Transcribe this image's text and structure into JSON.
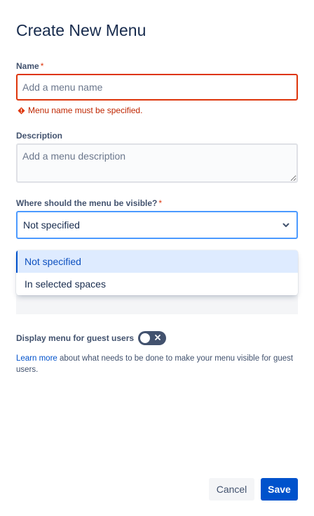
{
  "dialog": {
    "title": "Create New Menu"
  },
  "name_field": {
    "label": "Name",
    "required_mark": "*",
    "placeholder": "Add a menu name",
    "value": "",
    "error": "Menu name must be specified."
  },
  "description_field": {
    "label": "Description",
    "placeholder": "Add a menu description",
    "value": ""
  },
  "visibility_field": {
    "label": "Where should the menu be visible?",
    "required_mark": "*",
    "selected": "Not specified",
    "options": [
      {
        "label": "Not specified",
        "selected": true
      },
      {
        "label": "In selected spaces",
        "selected": false
      }
    ]
  },
  "guest_toggle": {
    "label": "Display menu for guest users",
    "on": false
  },
  "help": {
    "link_text": "Learn more",
    "text": " about what needs to be done to make your menu visible for guest users."
  },
  "footer": {
    "cancel_label": "Cancel",
    "save_label": "Save"
  },
  "colors": {
    "primary": "#0052cc",
    "error": "#de350b",
    "focus_border": "#4c9aff",
    "toggle_off": "#42526e"
  }
}
